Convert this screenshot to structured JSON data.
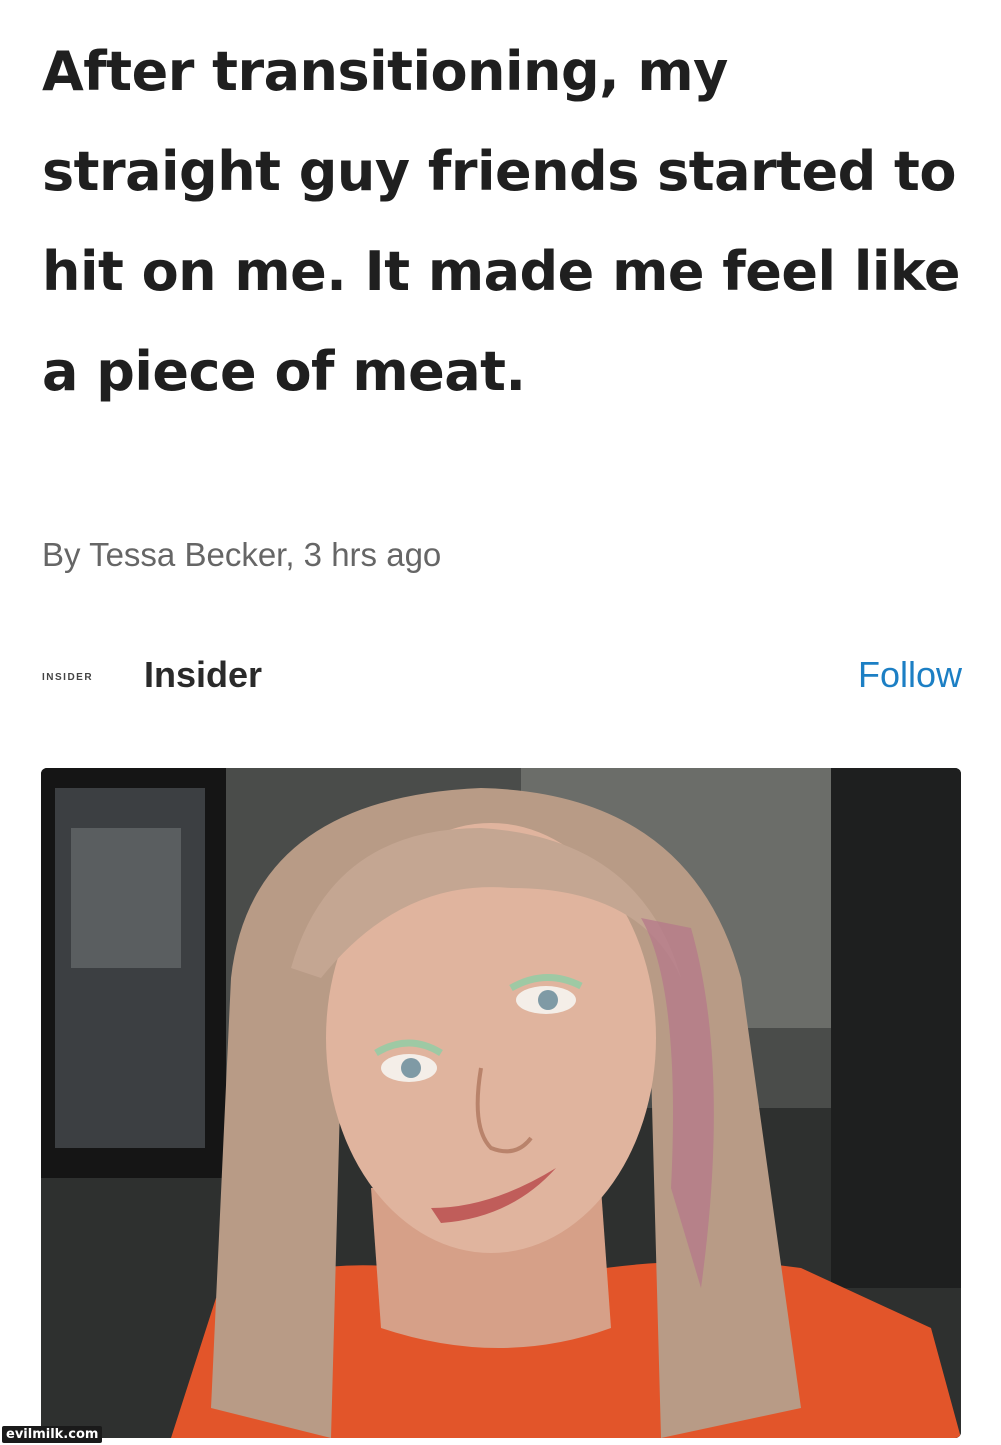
{
  "article": {
    "headline": "After transitioning, my straight guy friends started to hit on me. It made me feel like a piece of meat.",
    "byline": "By Tessa Becker, 3 hrs ago"
  },
  "publisher": {
    "logo_text": "INSIDER",
    "name": "Insider",
    "follow_label": "Follow"
  },
  "watermark": "evilmilk.com",
  "colors": {
    "follow_link": "#1c7fc4",
    "headline_text": "#1f1f1f",
    "byline_text": "#666666"
  }
}
